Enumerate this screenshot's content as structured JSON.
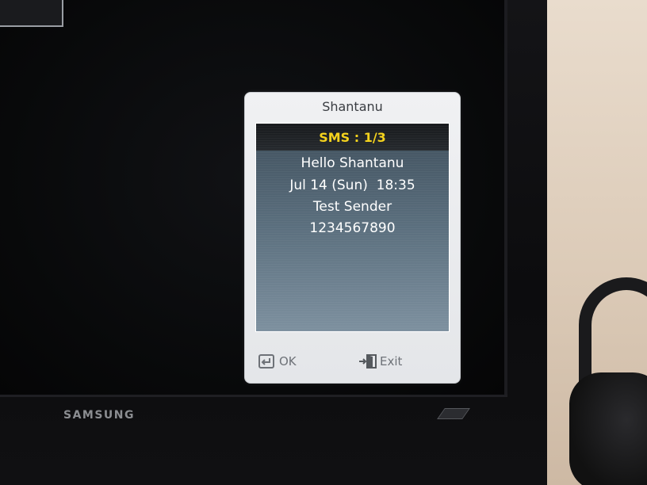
{
  "monitor": {
    "brand": "SAMSUNG"
  },
  "dialog": {
    "title": "Shantanu",
    "header": "SMS : 1/3",
    "lines": [
      "Hello Shantanu",
      "Jul 14 (Sun)  18:35",
      "Test Sender",
      "1234567890"
    ],
    "buttons": {
      "ok_label": "OK",
      "exit_label": "Exit"
    }
  },
  "colors": {
    "header_text": "#f5d21a",
    "panel_bg": "#5b6f7e",
    "dialog_bg": "#eceef0"
  },
  "icons": {
    "ok": "enter-icon",
    "exit": "exit-door-icon"
  }
}
